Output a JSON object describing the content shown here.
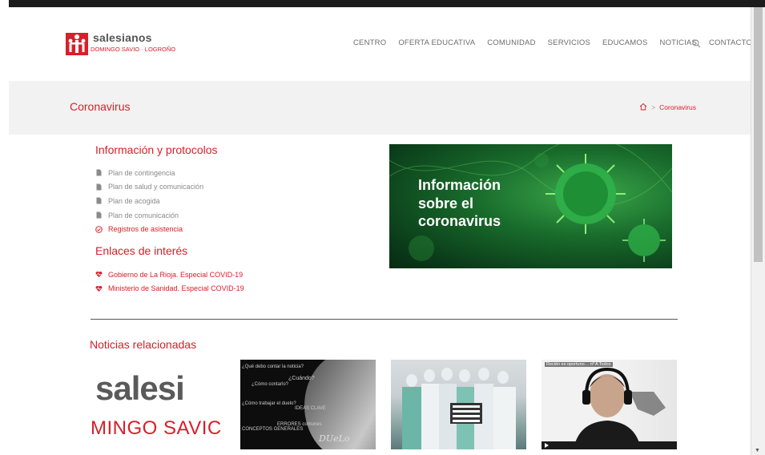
{
  "logo": {
    "name": "salesianos",
    "subtitle": "DOMINGO SAVIO · LOGROÑO"
  },
  "nav": {
    "items": [
      "CENTRO",
      "OFERTA EDUCATIVA",
      "COMUNIDAD",
      "SERVICIOS",
      "EDUCAMOS",
      "NOTICIAS",
      "CONTACTO"
    ],
    "search_icon": "search-icon"
  },
  "page": {
    "title": "Coronavirus"
  },
  "breadcrumb": {
    "home_icon": "home-icon",
    "separator": ">",
    "current": "Coronavirus"
  },
  "info": {
    "title": "Información y protocolos",
    "items": [
      {
        "label": "Plan de contingencia",
        "icon": "file-icon"
      },
      {
        "label": "Plan de salud y comunicación",
        "icon": "file-icon"
      },
      {
        "label": "Plan de acogida",
        "icon": "file-icon"
      },
      {
        "label": "Plan de comunicación",
        "icon": "file-icon"
      },
      {
        "label": "Registros de asistencia",
        "icon": "check-circle-icon"
      }
    ]
  },
  "links": {
    "title": "Enlaces de interés",
    "items": [
      {
        "label": "Gobierno de La Rioja. Especial COVID-19",
        "icon": "heartbeat-icon"
      },
      {
        "label": "Ministerio de Sanidad. Especial COVID-19",
        "icon": "heartbeat-icon"
      }
    ]
  },
  "banner": {
    "text": "Información\nsobre el\ncoronavirus"
  },
  "news": {
    "title": "Noticias relacionadas",
    "thumb1": {
      "big": "salesi",
      "sub": "MINGO SAVIC"
    },
    "thumb2": {
      "words": [
        "¿Qué debo contar la noticia?",
        "¿Cómo contarlo?",
        "¿Cuándo?",
        "¿Cómo trabajar el duelo?",
        "IDEAS CLAVE",
        "ERRORES comunes",
        "CONCEPTOS GENERALES"
      ],
      "duelo": "DUeLo"
    },
    "thumb4": {
      "title": "Recién es oportuno… nº A Todos"
    }
  },
  "colors": {
    "brand": "#d6202a",
    "nav_text": "#6c6c6c",
    "titlebar_bg": "#f2f2f2"
  }
}
